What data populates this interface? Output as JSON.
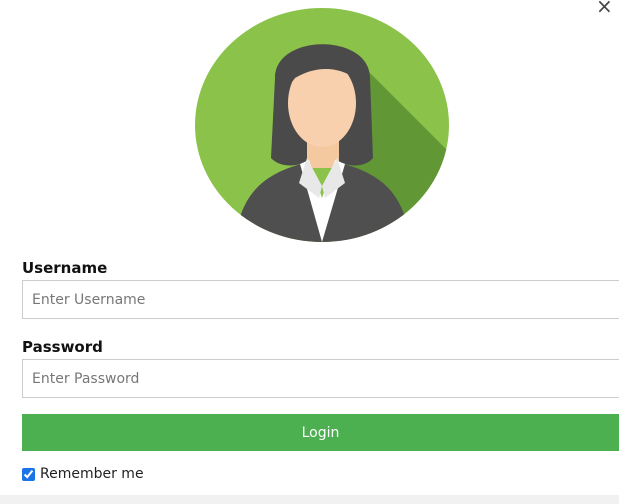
{
  "header": {
    "close_glyph": "×"
  },
  "avatar": {
    "icon": "user-avatar-woman-icon",
    "bg_color": "#8bc34a",
    "shadow_color": "#5a8f32"
  },
  "form": {
    "username": {
      "label": "Username",
      "placeholder": "Enter Username",
      "value": ""
    },
    "password": {
      "label": "Password",
      "placeholder": "Enter Password",
      "value": ""
    },
    "login_label": "Login",
    "login_color": "#4caf50",
    "remember": {
      "label": "Remember me",
      "checked": true
    }
  }
}
